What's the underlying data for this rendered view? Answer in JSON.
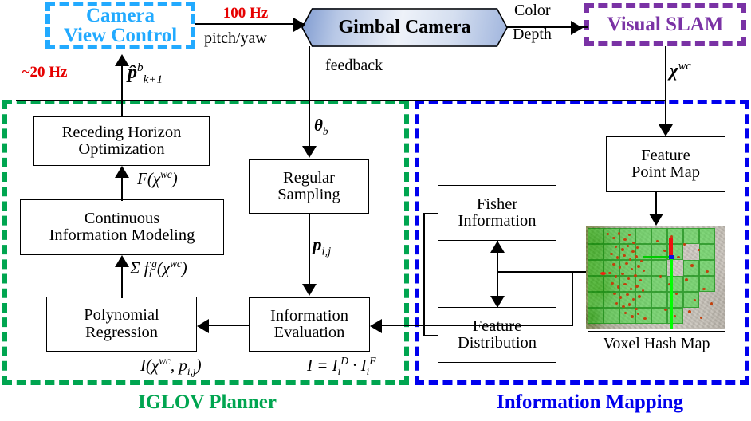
{
  "diagram": {
    "title": "IGLOV system architecture",
    "colors": {
      "cyan": "#22aaff",
      "purple": "#7a32a5",
      "green": "#00a550",
      "blue": "#0000ee",
      "red": "#e60000",
      "feature_point": "#c2400c",
      "voxel_green": "#22e122"
    }
  },
  "nodes": {
    "camera_view_control": {
      "line1": "Camera",
      "line2": "View Control"
    },
    "gimbal_camera": {
      "label": "Gimbal Camera"
    },
    "visual_slam": {
      "label": "Visual SLAM"
    },
    "receding_horizon": {
      "line1": "Receding Horizon",
      "line2": "Optimization"
    },
    "continuous_info_modeling": {
      "line1": "Continuous",
      "line2": "Information Modeling"
    },
    "polynomial_regression": {
      "line1": "Polynomial",
      "line2": "Regression"
    },
    "regular_sampling": {
      "line1": "Regular",
      "line2": "Sampling"
    },
    "information_evaluation": {
      "line1": "Information",
      "line2": "Evaluation"
    },
    "fisher_information": {
      "line1": "Fisher",
      "line2": "Information"
    },
    "feature_distribution": {
      "line1": "Feature",
      "line2": "Distribution"
    },
    "feature_point_map": {
      "line1": "Feature",
      "line2": "Point Map"
    },
    "voxel_hash_map": {
      "label": "Voxel Hash Map"
    }
  },
  "containers": {
    "iglov_planner": {
      "label": "IGLOV Planner"
    },
    "information_mapping": {
      "label": "Information Mapping"
    }
  },
  "edge_labels": {
    "rate_100hz": "100 Hz",
    "rate_20hz": "~20 Hz",
    "pitch_yaw": "pitch/yaw",
    "feedback": "feedback",
    "color": "Color",
    "depth": "Depth"
  },
  "math_labels": {
    "p_hat_next": "p̂",
    "p_hat_sup": "b",
    "p_hat_sub": "k+1",
    "chi_wc": "χ",
    "chi_wc_sup": "wc",
    "theta_b": "θ",
    "theta_b_sub": "b",
    "p_ij": "p",
    "p_ij_sub": "i,j",
    "F_chi": "F(χ",
    "F_chi_sup": "wc",
    "F_chi_close": ")",
    "sum_f": "Σ f",
    "sum_f_sub": "i",
    "sum_f_sup": "g",
    "sum_f_arg": "(χ",
    "sum_f_arg_sup": "wc",
    "sum_f_close": ")",
    "I_chi_p": "I(χ",
    "I_chi_p_sup": "wc",
    "I_chi_p_mid": ", p",
    "I_chi_p_sub": "i,j",
    "I_chi_p_close": ")",
    "I_eq": "I = I",
    "I_eq_sub1": "i",
    "I_eq_sup1": "D",
    "I_eq_dot": " · I",
    "I_eq_sub2": "i",
    "I_eq_sup2": "F"
  }
}
